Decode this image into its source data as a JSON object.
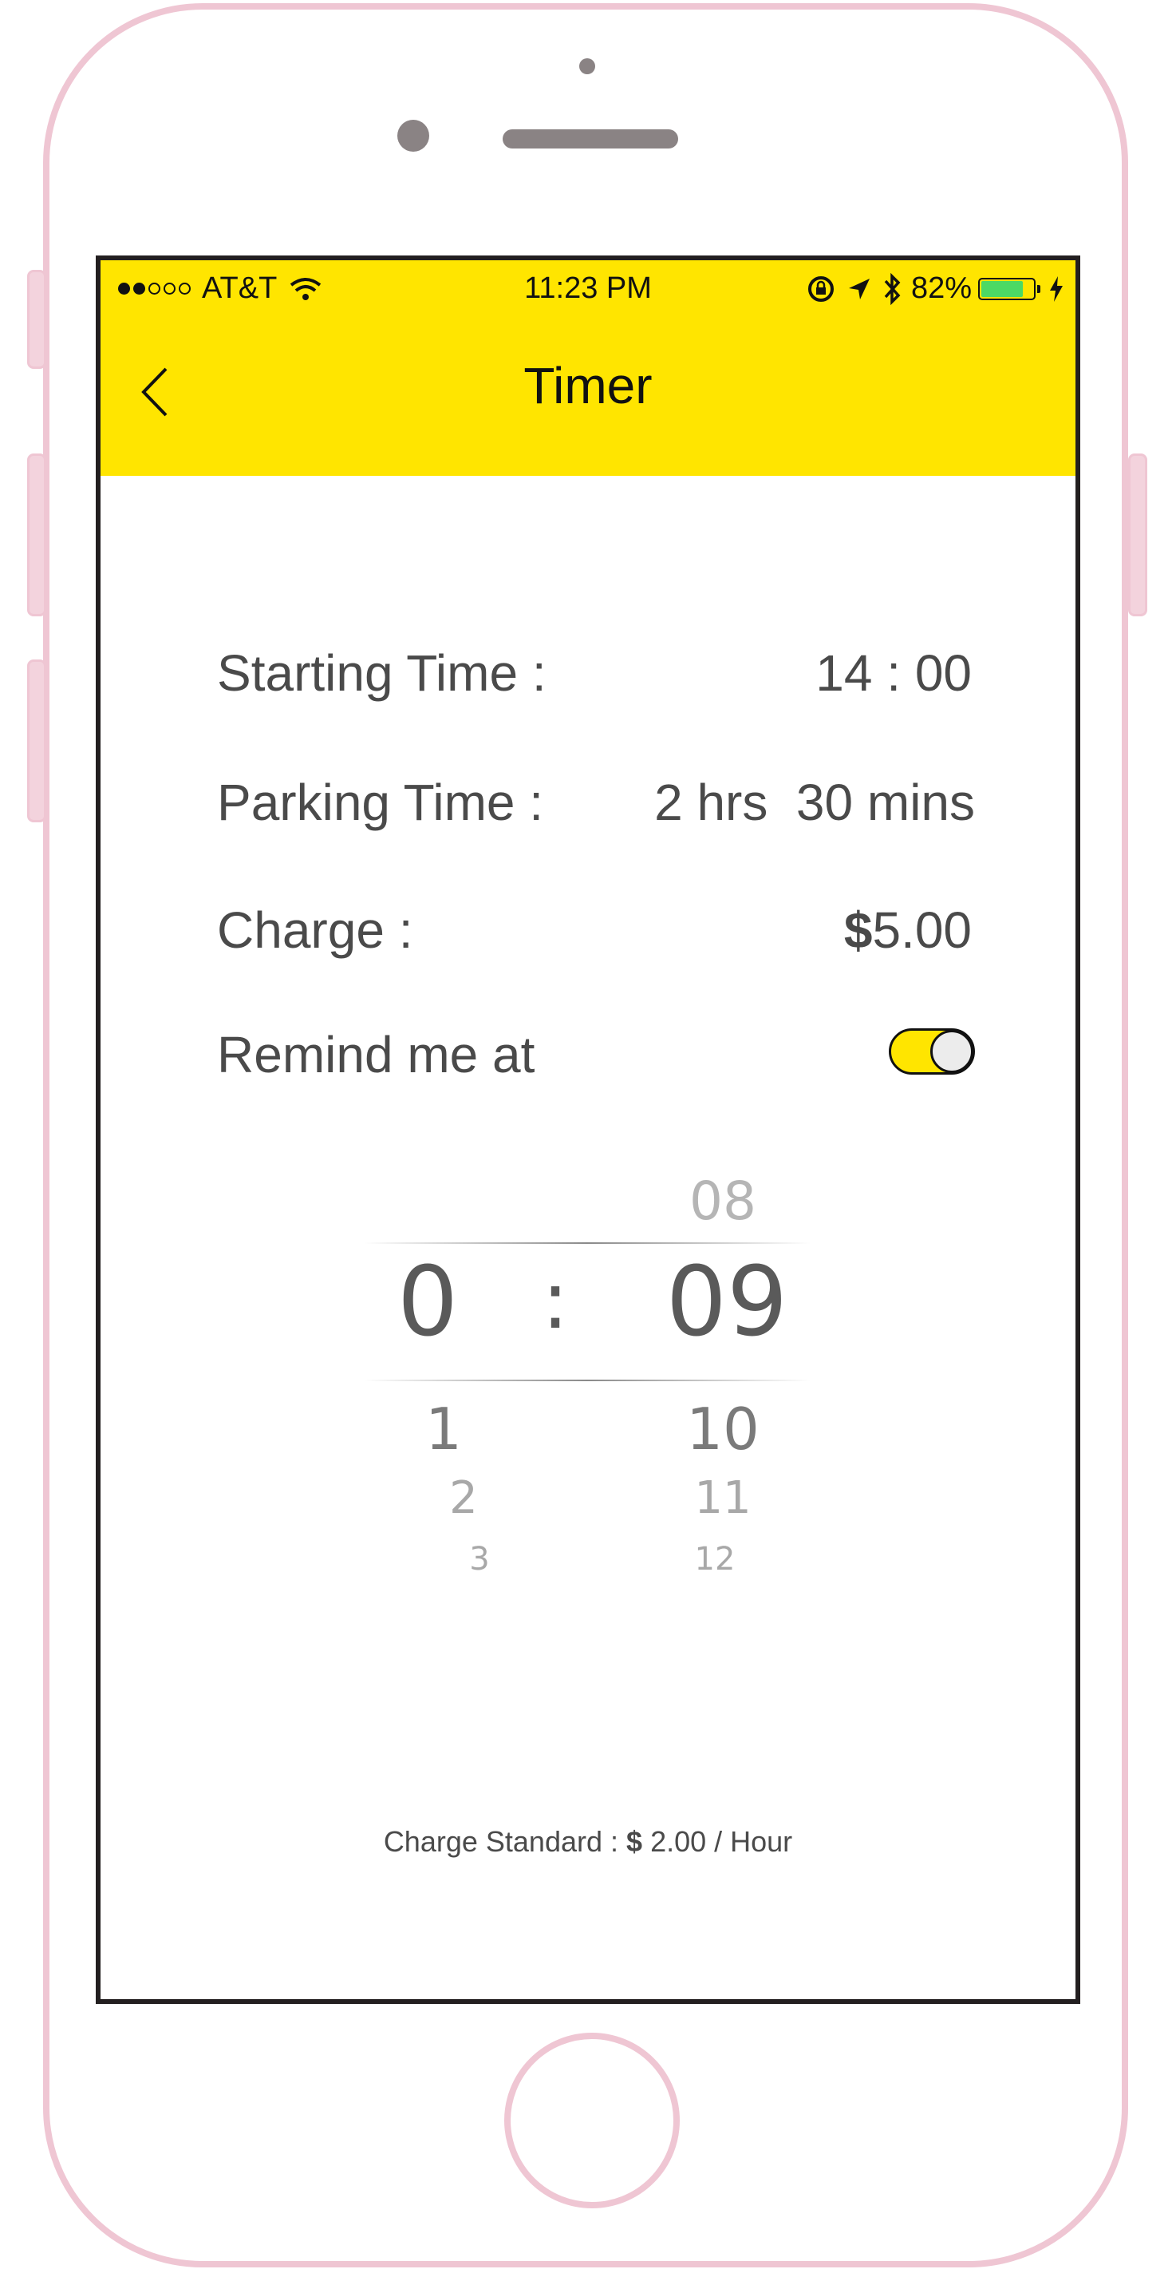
{
  "status_bar": {
    "carrier": "AT&T",
    "time": "11:23 PM",
    "battery_percent": "82%",
    "battery_level": 0.82,
    "battery_color": "#4cd964",
    "icons": [
      "signal-dots-icon",
      "wifi-icon",
      "rotation-lock-icon",
      "location-arrow-icon",
      "bluetooth-icon",
      "battery-icon",
      "charging-bolt-icon"
    ]
  },
  "nav": {
    "title": "Timer",
    "back_icon": "chevron-left-icon",
    "background_color": "#ffe500"
  },
  "details": {
    "starting_time": {
      "label": "Starting Time :",
      "value": "14 : 00"
    },
    "parking_time": {
      "label": "Parking Time :",
      "hours": "2 hrs",
      "minutes": "30 mins"
    },
    "charge": {
      "label": "Charge :",
      "currency": "$",
      "amount": "5.00"
    },
    "remind": {
      "label": "Remind me at",
      "enabled": true
    }
  },
  "picker": {
    "hours": {
      "selected": "0",
      "below": [
        "1",
        "2",
        "3"
      ]
    },
    "separator": ":",
    "minutes": {
      "above": "08",
      "selected": "09",
      "below": [
        "10",
        "11",
        "12"
      ]
    }
  },
  "footer": {
    "text": "Charge Standard :",
    "currency": "$",
    "rate": "2.00 / Hour"
  }
}
